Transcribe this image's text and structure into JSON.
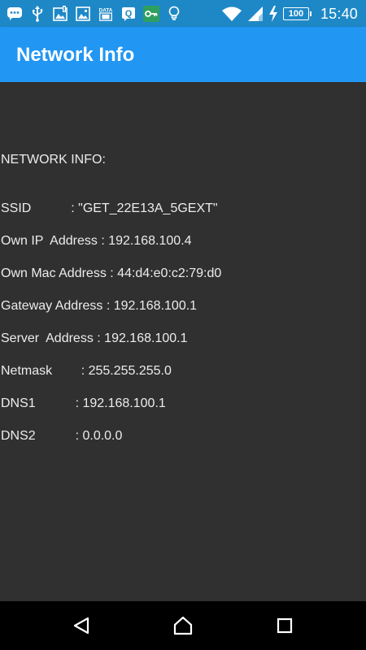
{
  "status_bar": {
    "time": "15:40",
    "battery": "100",
    "left_icons": [
      "chat-icon",
      "usb-icon",
      "alert-image-icon",
      "image-icon",
      "data-icon",
      "q-icon",
      "vpn-key-icon",
      "bulb-icon"
    ],
    "right_icons": [
      "wifi-icon",
      "cell-signal-icon",
      "charging-icon"
    ]
  },
  "app_bar": {
    "title": "Network Info"
  },
  "content": {
    "heading": "NETWORK INFO:",
    "rows": [
      "SSID           : \"GET_22E13A_5GEXT\"",
      "Own IP  Address : 192.168.100.4",
      "Own Mac Address : 44:d4:e0:c2:79:d0",
      "Gateway Address : 192.168.100.1",
      "Server  Address : 192.168.100.1",
      "Netmask        : 255.255.255.0",
      "DNS1           : 192.168.100.1",
      "DNS2           : 0.0.0.0"
    ]
  },
  "nav_bar": {
    "buttons": [
      "back-icon",
      "home-icon",
      "recents-icon"
    ]
  },
  "colors": {
    "status_bar": "#1e88c7",
    "app_bar": "#2196f3",
    "background": "#303030",
    "nav_bar": "#000000",
    "text": "#ececec"
  }
}
